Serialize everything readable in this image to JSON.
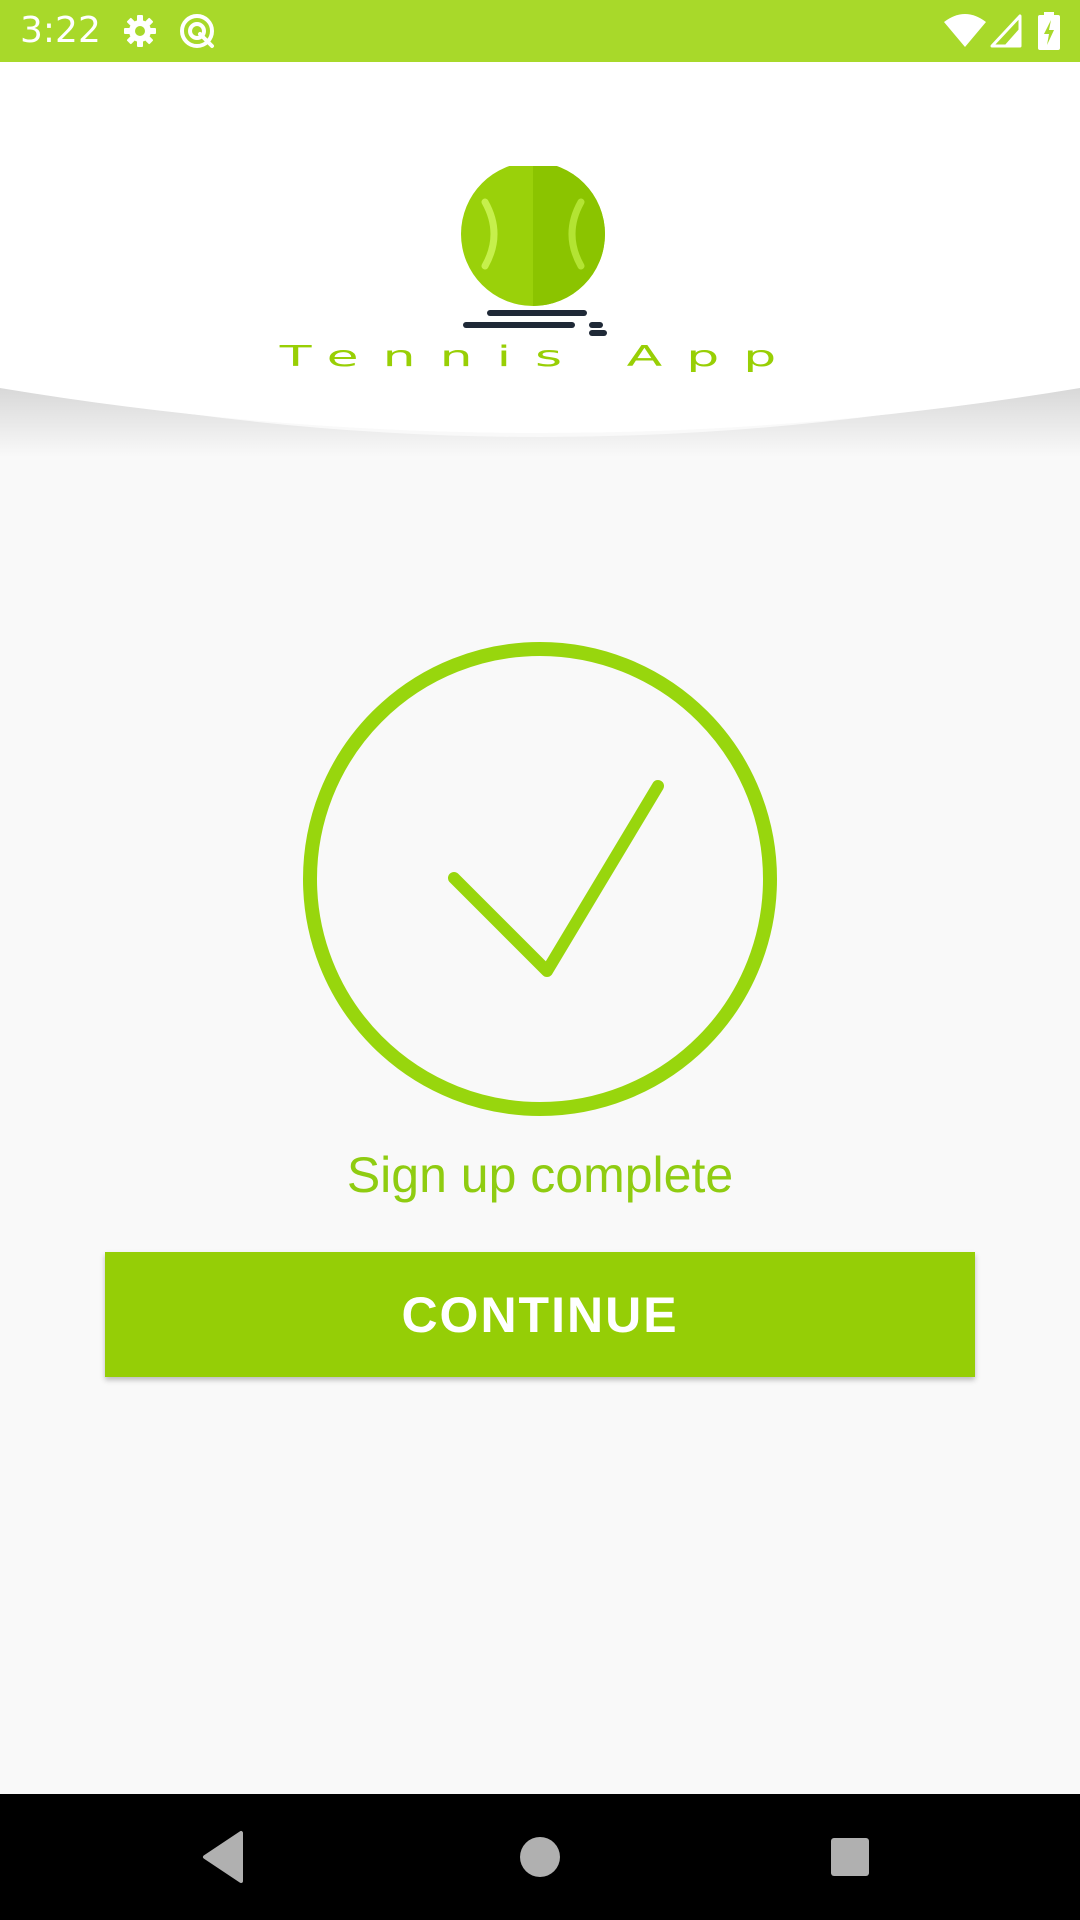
{
  "status_bar": {
    "time": "3:22",
    "background": "#a8d92a",
    "icons": [
      "settings-icon",
      "sync-icon",
      "wifi-icon",
      "signal-icon",
      "battery-charging-icon"
    ]
  },
  "header": {
    "app_name": "Tennis App",
    "logo_icon": "tennis-ball-icon"
  },
  "main": {
    "status_icon": "check-circle-icon",
    "message": "Sign up complete",
    "continue_label": "CONTINUE",
    "accent_color": "#95ce06"
  },
  "nav_bar": {
    "icons": [
      "back-icon",
      "home-icon",
      "recents-icon"
    ]
  }
}
